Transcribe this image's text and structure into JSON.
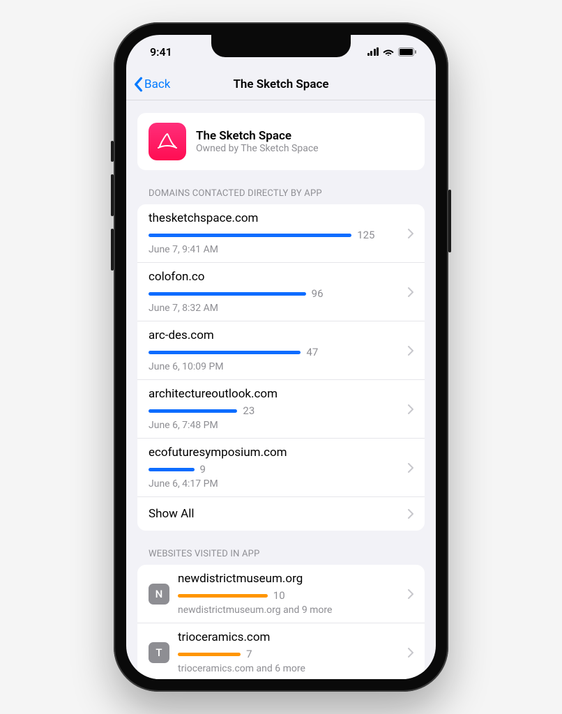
{
  "status": {
    "time": "9:41"
  },
  "nav": {
    "back_label": "Back",
    "title": "The Sketch Space"
  },
  "app": {
    "name": "The Sketch Space",
    "owner_line": "Owned by The Sketch Space"
  },
  "domains_section": {
    "header": "DOMAINS CONTACTED DIRECTLY BY APP",
    "items": [
      {
        "domain": "thesketchspace.com",
        "count": 125,
        "bar_pct": 80,
        "timestamp": "June 7, 9:41 AM"
      },
      {
        "domain": "colofon.co",
        "count": 96,
        "bar_pct": 62,
        "timestamp": "June 7, 8:32 AM"
      },
      {
        "domain": "arc-des.com",
        "count": 47,
        "bar_pct": 60,
        "timestamp": "June 6, 10:09 PM"
      },
      {
        "domain": "architectureoutlook.com",
        "count": 23,
        "bar_pct": 35,
        "timestamp": "June 6, 7:48 PM"
      },
      {
        "domain": "ecofuturesymposium.com",
        "count": 9,
        "bar_pct": 18,
        "timestamp": "June 6, 4:17 PM"
      }
    ],
    "show_all_label": "Show All"
  },
  "websites_section": {
    "header": "WEBSITES VISITED IN APP",
    "items": [
      {
        "badge": "N",
        "domain": "newdistrictmuseum.org",
        "count": 10,
        "bar_pct": 40,
        "subtitle": "newdistrictmuseum.org and 9 more"
      },
      {
        "badge": "T",
        "domain": "trioceramics.com",
        "count": 7,
        "bar_pct": 28,
        "subtitle": "trioceramics.com and 6 more"
      }
    ]
  }
}
